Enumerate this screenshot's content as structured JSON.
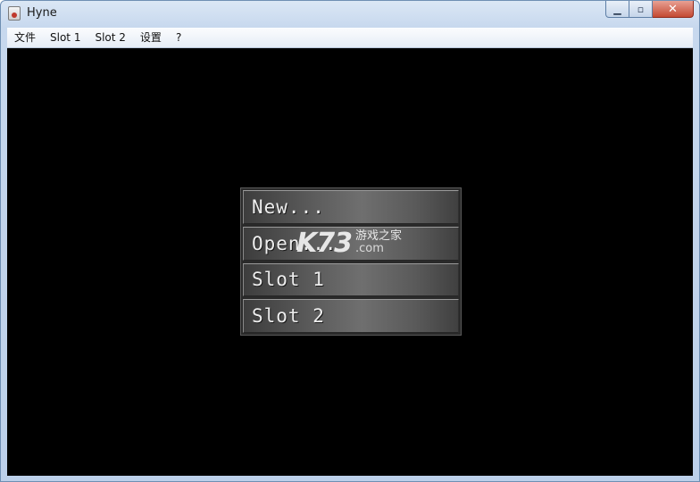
{
  "window": {
    "title": "Hyne",
    "controls": {
      "minimize": "▁",
      "maximize": "▫",
      "close": "✕"
    }
  },
  "menubar": {
    "items": [
      "文件",
      "Slot 1",
      "Slot 2",
      "设置",
      "?"
    ]
  },
  "main_menu": {
    "buttons": [
      "New...",
      "Open...",
      "Slot 1",
      "Slot 2"
    ]
  },
  "watermark": {
    "logo": "K73",
    "text_cn": "游戏之家",
    "text_domain": ".com"
  },
  "colors": {
    "client_background": "#000000",
    "button_text": "#eeeeee",
    "close_button": "#c44a33"
  }
}
